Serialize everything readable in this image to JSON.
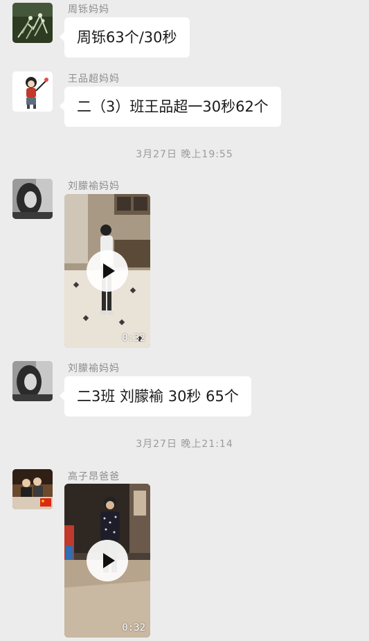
{
  "messages": [
    {
      "sender": "周铄妈妈",
      "text": "周铄63个/30秒",
      "avatar_icon": "plant-photo-icon"
    },
    {
      "sender": "王品超妈妈",
      "text": "二（3）班王品超一30秒62个",
      "avatar_icon": "cartoon-girl-icon"
    },
    {
      "timestamp": "3月27日 晚上19:55"
    },
    {
      "sender": "刘朦褕妈妈",
      "video_duration": "0:32",
      "avatar_icon": "portrait-photo-icon"
    },
    {
      "sender": "刘朦褕妈妈",
      "text": "二3班 刘朦褕 30秒 65个",
      "avatar_icon": "portrait-photo-icon"
    },
    {
      "timestamp": "3月27日 晚上21:14"
    },
    {
      "sender": "高子昂爸爸",
      "video_duration": "0:32",
      "avatar_icon": "family-photo-icon"
    }
  ],
  "colors": {
    "background": "#ececec",
    "bubble": "#ffffff",
    "sender_text": "#8c8c8c",
    "timestamp_text": "#9a9a9a"
  }
}
